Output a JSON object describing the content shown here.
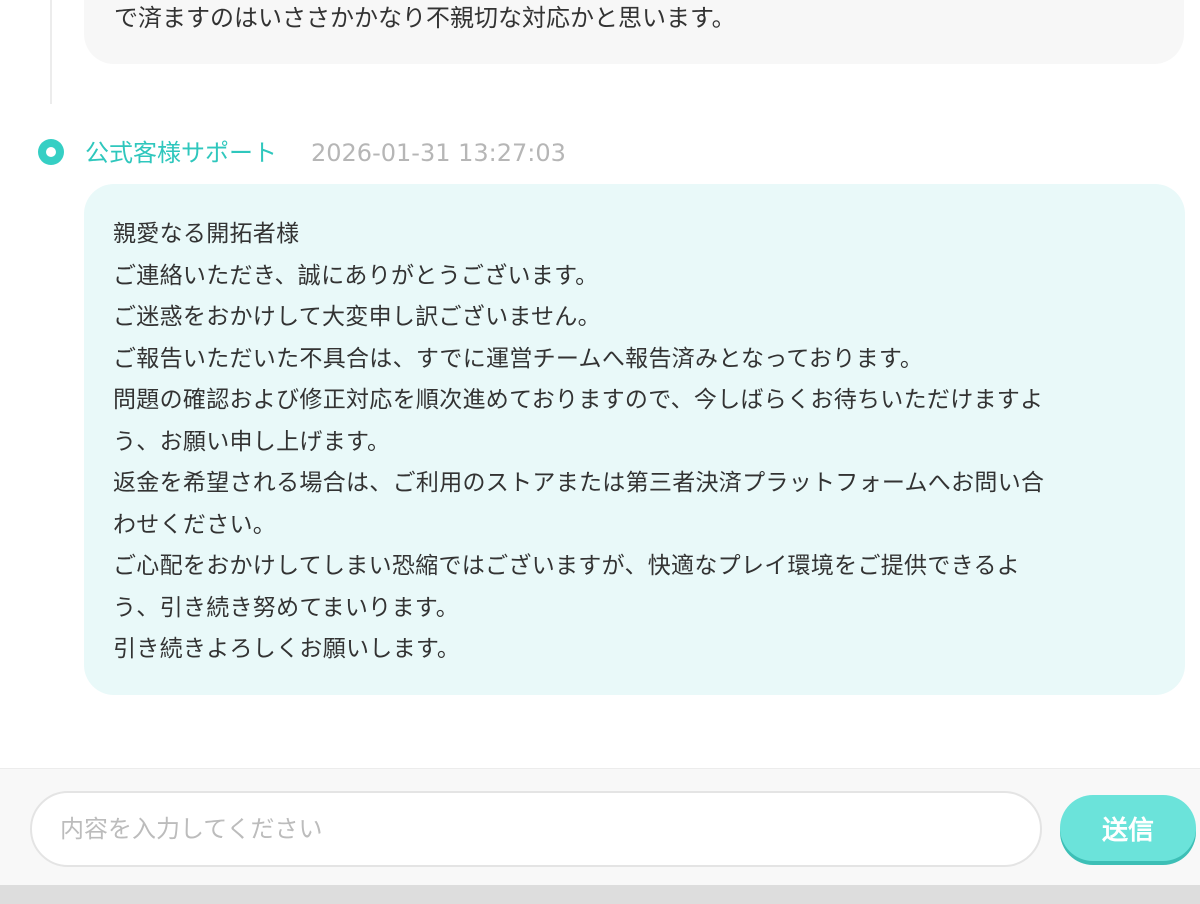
{
  "previous_message": {
    "text": "で済ますのはいささかかなり不親切な対応かと思います。"
  },
  "reply": {
    "sender": "公式客様サポート",
    "timestamp": "2026-01-31 13:27:03",
    "lines": [
      "親愛なる開拓者様",
      "ご連絡いただき、誠にありがとうございます。",
      "ご迷惑をおかけして大変申し訳ございません。",
      "ご報告いただいた不具合は、すでに運営チームへ報告済みとなっております。",
      "問題の確認および修正対応を順次進めておりますので、今しばらくお待ちいただけますよ",
      "う、お願い申し上げます。",
      "返金を希望される場合は、ご利用のストアまたは第三者決済プラットフォームへお問い合",
      "わせください。",
      "ご心配をおかけしてしまい恐縮ではございますが、快適なプレイ環境をご提供できるよ",
      "う、引き続き努めてまいります。",
      "引き続きよろしくお願いします。"
    ]
  },
  "composer": {
    "placeholder": "内容を入力してください",
    "value": "",
    "send_label": "送信"
  },
  "colors": {
    "accent": "#2fc7bd",
    "send_button": "#6be3da",
    "reply_bubble": "#e9f9f9",
    "timestamp": "#b6b6b6"
  }
}
